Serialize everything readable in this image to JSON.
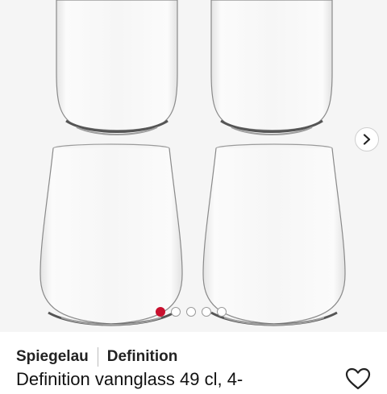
{
  "product": {
    "brand": "Spiegelau",
    "series": "Definition",
    "title": "Definition vannglass 49 cl, 4-"
  },
  "gallery": {
    "image_count": 5,
    "active_index": 0,
    "background_color": "#f5f5f5",
    "next_icon": "chevron-right-icon"
  },
  "actions": {
    "favorite_icon": "heart-outline-icon"
  },
  "colors": {
    "active_dot": "#c8102e",
    "text": "#222222"
  }
}
